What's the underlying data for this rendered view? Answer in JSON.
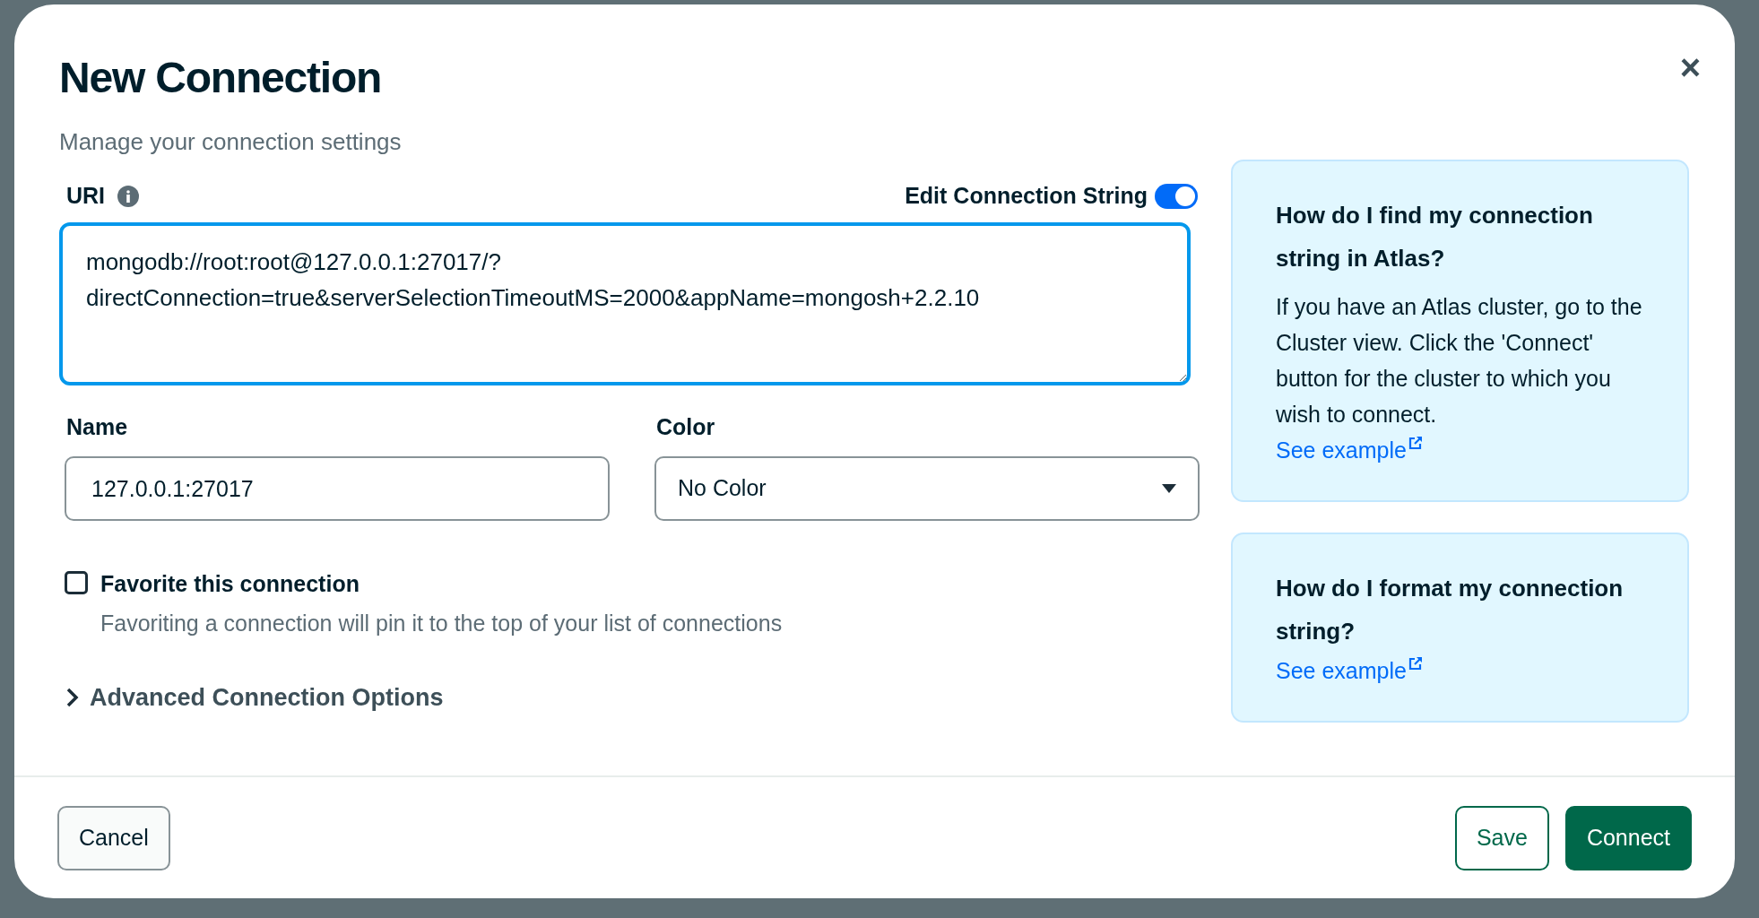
{
  "dialog": {
    "title": "New Connection",
    "subtitle": "Manage your connection settings",
    "close": "×"
  },
  "uri": {
    "label": "URI",
    "toggle_label": "Edit Connection String",
    "toggle_on": true,
    "value": "mongodb://root:root@127.0.0.1:27017/?directConnection=true&serverSelectionTimeoutMS=2000&appName=mongosh+2.2.10"
  },
  "name": {
    "label": "Name",
    "value": "127.0.0.1:27017"
  },
  "color": {
    "label": "Color",
    "value": "No Color"
  },
  "favorite": {
    "label": "Favorite this connection",
    "description": "Favoriting a connection will pin it to the top of your list of connections",
    "checked": false
  },
  "advanced": {
    "label": "Advanced Connection Options",
    "expanded": false
  },
  "help_cards": [
    {
      "title": "How do I find my connection string in Atlas?",
      "body": "If you have an Atlas cluster, go to the Cluster view. Click the 'Connect' button for the cluster to which you wish to connect.",
      "link": "See example"
    },
    {
      "title": "How do I format my connection string?",
      "link": "See example"
    }
  ],
  "buttons": [
    {
      "label": "Cancel",
      "kind": "secondary"
    },
    {
      "label": "Save",
      "kind": "outline"
    },
    {
      "label": "Connect",
      "kind": "primary"
    }
  ]
}
